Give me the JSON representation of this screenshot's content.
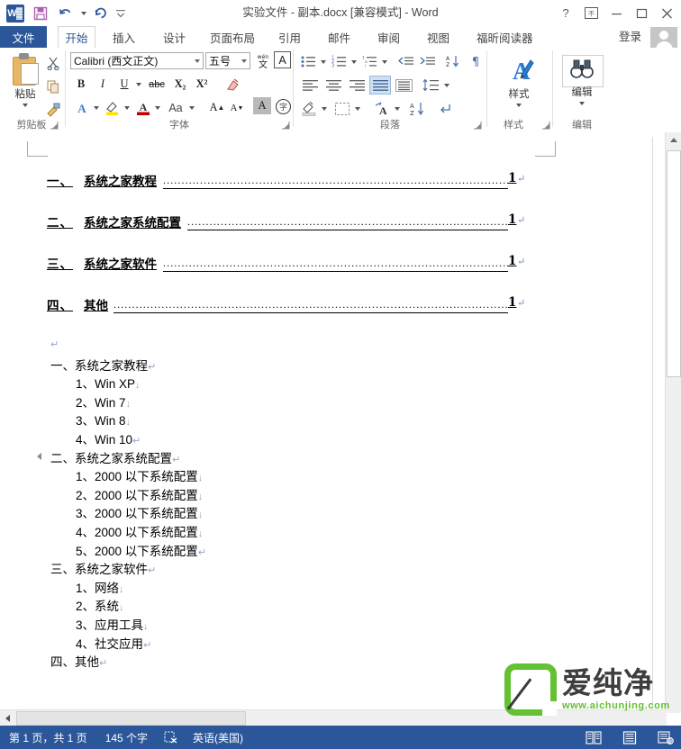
{
  "window": {
    "title": "实验文件 - 副本.docx [兼容模式] - Word",
    "quick_access": [
      {
        "name": "word-icon",
        "label": "W"
      },
      {
        "name": "save-icon",
        "label": "保存"
      },
      {
        "name": "undo-icon",
        "label": "撤消"
      },
      {
        "name": "redo-icon",
        "label": "恢复"
      },
      {
        "name": "customize-qat-icon",
        "label": "自定义快速访问工具栏"
      }
    ],
    "controls": [
      {
        "name": "help-button",
        "glyph": "?"
      },
      {
        "name": "ribbon-display-options-button",
        "glyph": "▣"
      },
      {
        "name": "minimize-button",
        "glyph": "—"
      },
      {
        "name": "restore-button",
        "glyph": "❐"
      },
      {
        "name": "close-button",
        "glyph": "✕"
      }
    ]
  },
  "ribbon": {
    "file_tab": "文件",
    "tabs": [
      {
        "label": "开始",
        "active": true
      },
      {
        "label": "插入",
        "active": false
      },
      {
        "label": "设计",
        "active": false
      },
      {
        "label": "页面布局",
        "active": false
      },
      {
        "label": "引用",
        "active": false
      },
      {
        "label": "邮件",
        "active": false
      },
      {
        "label": "审阅",
        "active": false
      },
      {
        "label": "视图",
        "active": false
      },
      {
        "label": "福昕阅读器",
        "active": false
      }
    ],
    "sign_in": "登录",
    "groups": {
      "clipboard": {
        "label": "剪贴板",
        "paste_label": "粘贴",
        "cut_label": "剪切",
        "copy_label": "复制",
        "format_painter_label": "格式刷"
      },
      "font": {
        "label": "字体",
        "font_name": "Calibri (西文正文)",
        "font_size": "五号",
        "phonetic_guide_label": "拼音指南",
        "char_border_label": "字符边框",
        "bold": "B",
        "italic": "I",
        "underline": "U",
        "strikethrough": "abc",
        "subscript": "X₂",
        "superscript": "X²",
        "clear_format_label": "清除所有格式",
        "text_effects_label": "文本效果",
        "highlight_label": "以不同颜色突出显示文本",
        "font_color_label": "字体颜色",
        "change_case_label": "Aa",
        "grow_font": "A",
        "shrink_font": "A",
        "shading_label": "字符底纹",
        "enclose_char_label": "带圈字符"
      },
      "paragraph": {
        "label": "段落",
        "bullets_label": "项目符号",
        "numbering_label": "编号",
        "multilevel_label": "多级列表",
        "decrease_indent_label": "减少缩进量",
        "increase_indent_label": "增加缩进量",
        "sort_label": "排序",
        "show_marks_label": "显示编辑标记",
        "align_left_label": "左对齐",
        "align_center_label": "居中",
        "align_right_label": "右对齐",
        "justify_label": "两端对齐",
        "distribute_label": "分散对齐",
        "line_spacing_label": "行和段落间距",
        "shading_label": "底纹",
        "borders_label": "边框"
      },
      "styles": {
        "label": "样式",
        "button_label": "样式"
      },
      "editing": {
        "label": "编辑",
        "button_label": "编辑"
      }
    }
  },
  "document": {
    "toc": [
      {
        "num": "一、",
        "title": "系统之家教程",
        "page": "1"
      },
      {
        "num": "二、",
        "title": "系统之家系统配置",
        "page": "1"
      },
      {
        "num": "三、",
        "title": "系统之家软件",
        "page": "1"
      },
      {
        "num": "四、",
        "title": "其他",
        "page": "1"
      }
    ],
    "paragraph_mark": "↵",
    "line_break_mark": "↓",
    "body": [
      {
        "level": 0,
        "text": "",
        "mark": "↵",
        "collapse": false
      },
      {
        "level": 1,
        "text": "一、系统之家教程",
        "mark": "↵",
        "collapse": false
      },
      {
        "level": 2,
        "text": "1、Win XP",
        "mark": "↓",
        "collapse": false
      },
      {
        "level": 2,
        "text": "2、Win 7",
        "mark": "↓",
        "collapse": false
      },
      {
        "level": 2,
        "text": "3、Win 8",
        "mark": "↓",
        "collapse": false
      },
      {
        "level": 2,
        "text": "4、Win 10",
        "mark": "↵",
        "collapse": false
      },
      {
        "level": 1,
        "text": "二、系统之家系统配置",
        "mark": "↵",
        "collapse": true
      },
      {
        "level": 2,
        "text": "1、2000 以下系统配置",
        "mark": "↓",
        "collapse": false
      },
      {
        "level": 2,
        "text": "2、2000 以下系统配置",
        "mark": "↓",
        "collapse": false
      },
      {
        "level": 2,
        "text": "3、2000 以下系统配置",
        "mark": "↓",
        "collapse": false
      },
      {
        "level": 2,
        "text": "4、2000 以下系统配置",
        "mark": "↓",
        "collapse": false
      },
      {
        "level": 2,
        "text": "5、2000 以下系统配置",
        "mark": "↵",
        "collapse": false
      },
      {
        "level": 1,
        "text": "三、系统之家软件",
        "mark": "↵",
        "collapse": false
      },
      {
        "level": 2,
        "text": "1、网络",
        "mark": "↓",
        "collapse": false
      },
      {
        "level": 2,
        "text": "2、系统",
        "mark": "↓",
        "collapse": false
      },
      {
        "level": 2,
        "text": "3、应用工具",
        "mark": "↓",
        "collapse": false
      },
      {
        "level": 2,
        "text": "4、社交应用",
        "mark": "↵",
        "collapse": false
      },
      {
        "level": 1,
        "text": "四、其他",
        "mark": "↵",
        "collapse": false
      }
    ]
  },
  "status_bar": {
    "page_info": "第 1 页，共 1 页",
    "word_count": "145 个字",
    "proofing_label": "校对",
    "language": "英语(美国)",
    "views": [
      {
        "name": "read-mode-view-button",
        "label": "阅读视图"
      },
      {
        "name": "print-layout-view-button",
        "label": "页面视图"
      },
      {
        "name": "web-layout-view-button",
        "label": "Web 版式视图"
      }
    ]
  },
  "watermark": {
    "brand": "爱纯净",
    "url": "www.aichunjing.com",
    "accent": "#63c132"
  },
  "colors": {
    "accent": "#2b579a",
    "ribbon_bg": "#ffffff",
    "selection": "#cde0f5"
  }
}
